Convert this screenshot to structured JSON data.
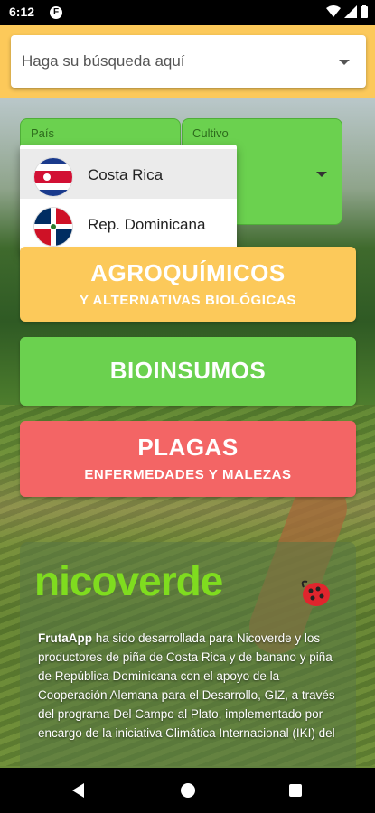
{
  "status_bar": {
    "time": "6:12",
    "app_icon": "F"
  },
  "search": {
    "placeholder": "Haga su búsqueda aquí"
  },
  "selectors": {
    "pais_label": "País",
    "cultivo_label": "Cultivo"
  },
  "country_menu": {
    "items": [
      {
        "label": "Costa Rica",
        "flag": "costa-rica-flag"
      },
      {
        "label": "Rep. Dominicana",
        "flag": "dominican-republic-flag"
      }
    ],
    "highlighted_index": 0
  },
  "categories": {
    "agroquimicos": {
      "title": "AGROQUÍMICOS",
      "subtitle": "Y ALTERNATIVAS BIOLÓGICAS"
    },
    "bioinsumos": {
      "title": "BIOINSUMOS"
    },
    "plagas": {
      "title": "PLAGAS",
      "subtitle": "ENFERMEDADES Y MALEZAS"
    }
  },
  "info": {
    "logo": "nicoverde",
    "app_name": "FrutaApp",
    "text": " ha sido desarrollada para Nicoverde y los productores de piña de Costa Rica y de banano y piña de República Dominicana con el apoyo de la Cooperación Alemana para el Desarrollo, GIZ, a través del programa Del Campo al Plato, implementado por encargo de la iniciativa Climática Internacional (IKI) del"
  },
  "colors": {
    "yellow": "#fcc95a",
    "green": "#6bd14f",
    "red": "#f36565",
    "logo_green": "#7fdc1f"
  }
}
